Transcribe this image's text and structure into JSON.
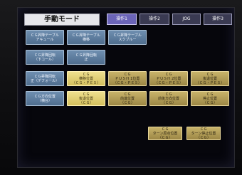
{
  "header": {
    "title": "手動モード",
    "tabs": [
      "操作1",
      "操作2",
      "JOG",
      "操作3"
    ]
  },
  "buttons": {
    "r1": [
      "ＣＧ昇降テーブル\nアキュール",
      "ＣＧ昇降テーブル\n横移",
      "ＣＧ昇降テーブル\nスクブルー"
    ],
    "r2": [
      "ＣＧ昇降回転\n（下コール）",
      "ＣＧ昇降回転\n正"
    ],
    "r3": [
      "ＣＧ昇降回転\n正（デフォール）",
      "ＣＧ\n横移位置\n（ＣＧ・ＰＥＳ）",
      "ＣＧ\nＰＵＳＨ 1位置\n（ＣＧ・ＰＥＳ）",
      "ＣＧ\nＰＵＳＨ 2位置\n（ＣＧ・ＰＥＳ）",
      "ＣＧ\n後退位置\n（ＣＧ・ＰＥＳ）"
    ],
    "r4": [
      "ＣＧ方向位置\n（横台）",
      "ＣＧ\n後退位置\n（ＣＧ）",
      "ＣＧ\n前進位置\n（ＣＧ）",
      "ＣＧ\n前後方向位置\n（ＣＧ）",
      "ＣＧ\n停止位置\n（ＣＧ）"
    ],
    "r5": [
      "ＣＧ\nターン原点位置\n（ＣＧ）",
      "ＣＧ\nターン停止位置\n（ＣＧ）"
    ]
  },
  "colors": {
    "tab_active": "#6b64b8",
    "button_blue": "#5f7ea0",
    "button_gold": "#b39d56",
    "button_yellow": "#e2d06f"
  }
}
